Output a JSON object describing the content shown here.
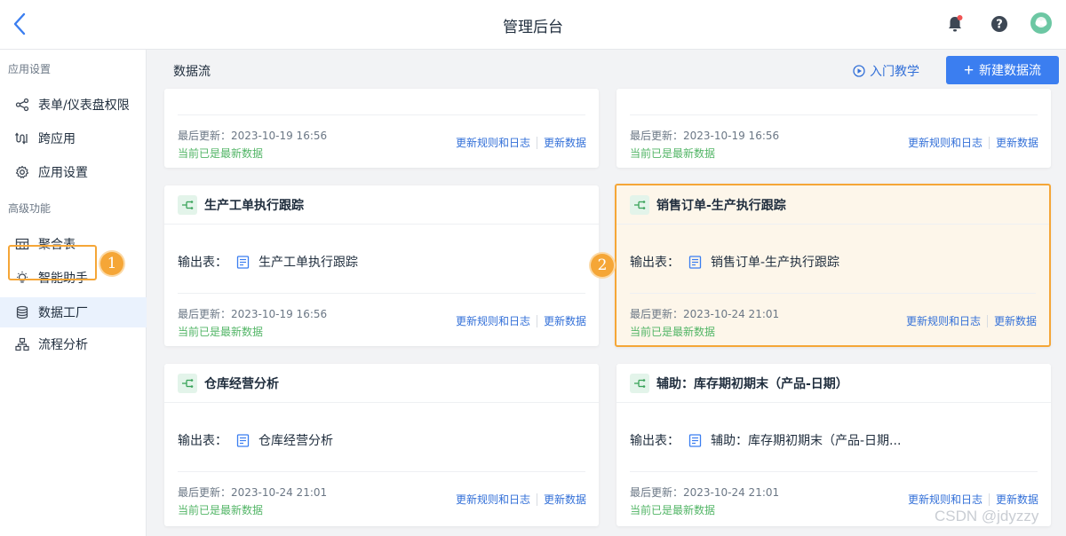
{
  "header": {
    "title": "管理后台"
  },
  "sidebar": {
    "group_app": "应用设置",
    "group_advanced": "高级功能",
    "items": [
      {
        "label": "表单/仪表盘权限",
        "icon": "share-icon"
      },
      {
        "label": "跨应用",
        "icon": "cross-app-icon"
      },
      {
        "label": "应用设置",
        "icon": "gear-icon"
      },
      {
        "label": "聚合表",
        "icon": "table-icon"
      },
      {
        "label": "智能助手",
        "icon": "bulb-icon"
      },
      {
        "label": "数据工厂",
        "icon": "database-icon",
        "active": true
      },
      {
        "label": "流程分析",
        "icon": "flowchart-icon"
      }
    ]
  },
  "annotations": {
    "badge_1": "1",
    "badge_2": "2"
  },
  "content": {
    "title": "数据流",
    "tutorial_label": "入门教学",
    "new_button_label": "新建数据流"
  },
  "cards": [
    {
      "updated": "最后更新：2023-10-19 16:56",
      "status": "当前已是最新数据",
      "link_rules": "更新规则和日志",
      "link_update": "更新数据"
    },
    {
      "updated": "最后更新：2023-10-19 16:56",
      "status": "当前已是最新数据",
      "link_rules": "更新规则和日志",
      "link_update": "更新数据"
    },
    {
      "title": "生产工单执行跟踪",
      "output_label": "输出表：",
      "output_table": "生产工单执行跟踪",
      "updated": "最后更新：2023-10-19 16:56",
      "status": "当前已是最新数据",
      "link_rules": "更新规则和日志",
      "link_update": "更新数据"
    },
    {
      "title": "销售订单-生产执行跟踪",
      "output_label": "输出表：",
      "output_table": "销售订单-生产执行跟踪",
      "updated": "最后更新：2023-10-24 21:01",
      "status": "当前已是最新数据",
      "link_rules": "更新规则和日志",
      "link_update": "更新数据",
      "highlighted": true
    },
    {
      "title": "仓库经营分析",
      "output_label": "输出表：",
      "output_table": "仓库经营分析",
      "updated": "最后更新：2023-10-24 21:01",
      "status": "当前已是最新数据",
      "link_rules": "更新规则和日志",
      "link_update": "更新数据"
    },
    {
      "title": "辅助：库存期初期末（产品-日期）",
      "output_label": "输出表：",
      "output_table": "辅助：库存期初期末（产品-日期...",
      "updated": "最后更新：2023-10-24 21:01",
      "status": "当前已是最新数据",
      "link_rules": "更新规则和日志",
      "link_update": "更新数据"
    }
  ],
  "watermark": "CSDN @jdyzzy",
  "colors": {
    "accent": "#3b7ef0",
    "highlight": "#f5a637",
    "status_green": "#52b566"
  }
}
